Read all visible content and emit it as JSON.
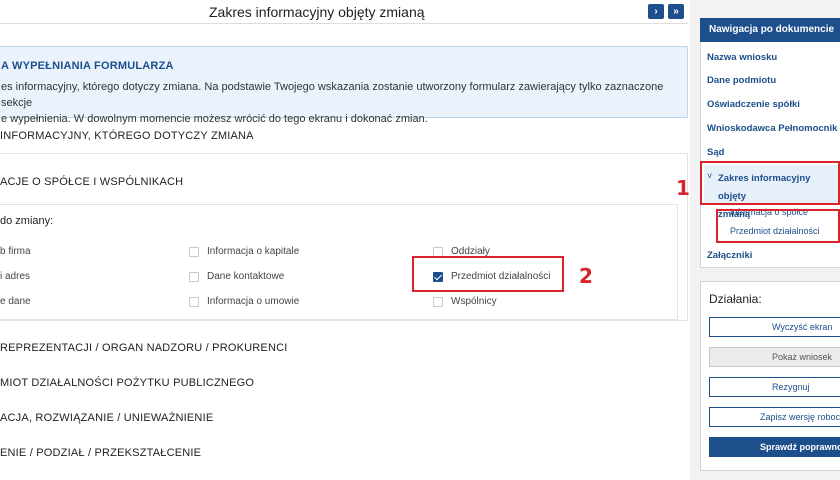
{
  "header": {
    "title": "Zakres informacyjny objęty zmianą",
    "next_icon": "›",
    "last_icon": "»"
  },
  "instructions": {
    "title": "A WYPEŁNIANIA FORMULARZA",
    "line1": "es informacyjny, którego dotyczy zmiana. Na podstawie Twojego wskazania zostanie utworzony formularz zawierający tylko zaznaczone sekcje",
    "line2": "e wypełnienia. W dowolnym momencie możesz wrócić do tego ekranu i dokonać zmian."
  },
  "sections": {
    "scope": "INFORMACYJNY, KTÓREGO DOTYCZY ZMIANA",
    "company": "ACJE O SPÓŁCE I WSPÓLNIKACH",
    "change_label": "do zmiany:",
    "reprezentacja": "REPREZENTACJI / ORGAN NADZORU / PROKURENCI",
    "opp": "MIOT DZIAŁALNOŚCI POŻYTKU PUBLICZNEGO",
    "likwidacja": "ACJA, ROZWIĄZANIE / UNIEWAŻNIENIE",
    "polaczenie": "ENIE / PODZIAŁ / PRZEKSZTAŁCENIE"
  },
  "options": {
    "col1": [
      "b firma",
      "i adres",
      "e dane"
    ],
    "col2": [
      "Informacja o kapitale",
      "Dane kontaktowe",
      "Informacja o umowie"
    ],
    "col3": [
      "Oddziały",
      "Przedmiot działalności",
      "Wspólnicy"
    ],
    "checked": "Przedmiot działalności"
  },
  "annotations": {
    "one": "1",
    "two": "2"
  },
  "nav": {
    "header": "Nawigacja po dokumencie",
    "items": [
      "Nazwa wniosku",
      "Dane podmiotu",
      "Oświadczenie spółki",
      "Wnioskodawca Pełnomocnik",
      "Sąd"
    ],
    "active_line1": "Zakres informacyjny objęty",
    "active_line2": "zmianą",
    "chevron": "˅",
    "sub_items": [
      "Informacja o spółce",
      "Przedmiot działalności"
    ],
    "last": "Załączniki"
  },
  "actions": {
    "title": "Działania:",
    "buttons": [
      "Wyczyść ekran",
      "Pokaż wniosek",
      "Rezygnuj",
      "Zapisz wersję roboczą",
      "Sprawdź poprawność"
    ]
  },
  "colors": {
    "accent": "#1d4f8c",
    "annotation": "#d9232d",
    "info_bg": "#eaf3fb"
  }
}
